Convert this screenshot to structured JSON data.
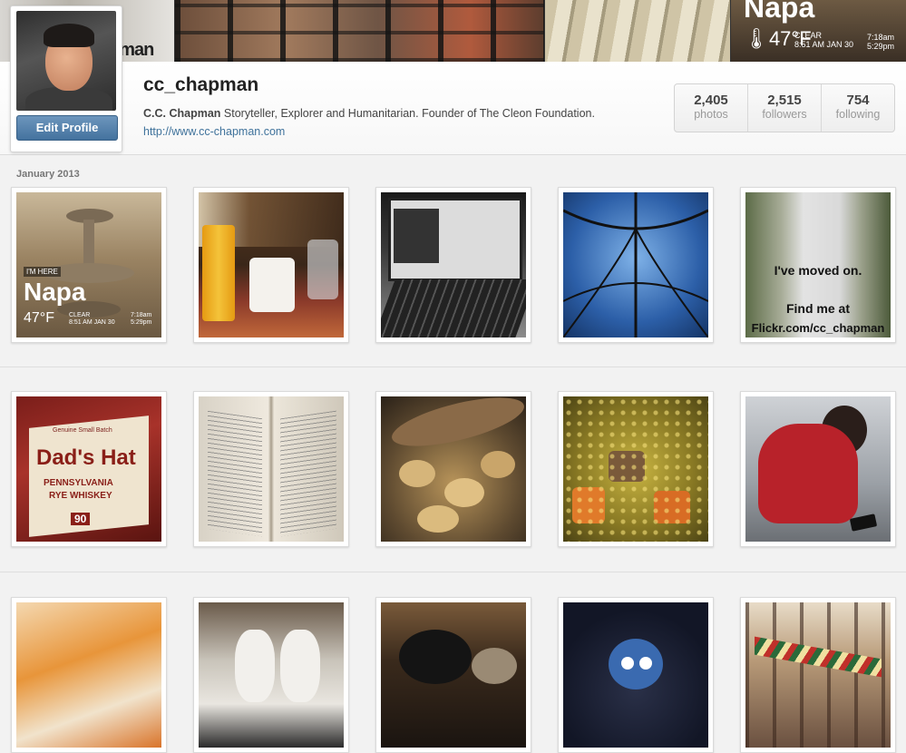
{
  "banner": {
    "partial_text": "pman",
    "napa_title": "Napa",
    "temperature": "47°F",
    "condition": "CLEAR",
    "datetime": "8:51 AM JAN 30",
    "sunrise": "7:18am",
    "sunset": "5:29pm"
  },
  "profile": {
    "username": "cc_chapman",
    "display_name": "C.C. Chapman",
    "bio": "Storyteller, Explorer and Humanitarian. Founder of The Cleon Foundation.",
    "website": "http://www.cc-chapman.com",
    "edit_button": "Edit Profile"
  },
  "stats": [
    {
      "count": "2,405",
      "label": "photos"
    },
    {
      "count": "2,515",
      "label": "followers"
    },
    {
      "count": "754",
      "label": "following"
    }
  ],
  "feed": {
    "month_label": "January 2013",
    "photos": [
      {
        "subject": "napa-fountain",
        "overlay": {
          "im_here": "I'M HERE",
          "title": "Napa",
          "temp": "47°F",
          "condition": "CLEAR",
          "datetime": "8:51 AM JAN 30",
          "sunrise": "7:18am",
          "sunset": "5:29pm"
        }
      },
      {
        "subject": "juice-and-coffee-mug"
      },
      {
        "subject": "laptop"
      },
      {
        "subject": "blue-dome"
      },
      {
        "subject": "snowy-path",
        "overlay": {
          "line1": "I've moved on.",
          "line2": "Find me at",
          "line3": "Flickr.com/cc_chapman"
        }
      },
      {
        "subject": "dads-hat-whiskey",
        "overlay": {
          "small": "Genuine Small Batch",
          "brand": "Dad's Hat",
          "sub": "PENNSYLVANIA",
          "sub2": "RYE WHISKEY",
          "proof": "90"
        }
      },
      {
        "subject": "open-book"
      },
      {
        "subject": "roasted-potatoes"
      },
      {
        "subject": "vegetable-stew"
      },
      {
        "subject": "child-with-phone"
      },
      {
        "subject": "orange-peels"
      },
      {
        "subject": "plush-toys"
      },
      {
        "subject": "sleeping-cat"
      },
      {
        "subject": "angry-bird-logo"
      },
      {
        "subject": "atrium-mobile"
      }
    ]
  },
  "colors": {
    "link": "#3f729b",
    "button": "#44729e",
    "background": "#f2f2f2"
  }
}
